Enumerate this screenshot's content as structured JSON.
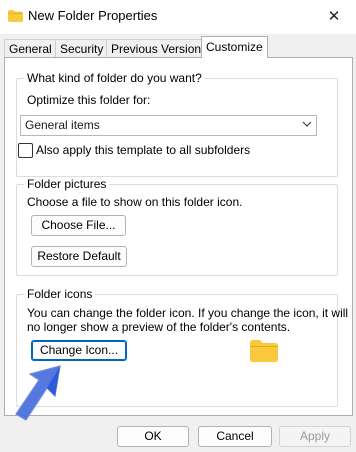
{
  "window": {
    "title": "New Folder Properties",
    "close_glyph": "✕"
  },
  "tabs": [
    {
      "label": "General"
    },
    {
      "label": "Security"
    },
    {
      "label": "Previous Versions"
    },
    {
      "label": "Customize"
    }
  ],
  "active_tab": "Customize",
  "folder_type": {
    "legend": "What kind of folder do you want?",
    "optimize_label": "Optimize this folder for:",
    "selected": "General items",
    "apply_subfolders_label": "Also apply this template to all subfolders",
    "apply_subfolders_checked": false
  },
  "folder_pictures": {
    "legend": "Folder pictures",
    "description": "Choose a file to show on this folder icon.",
    "choose_file_label": "Choose File...",
    "restore_default_label": "Restore Default"
  },
  "folder_icons": {
    "legend": "Folder icons",
    "description_line1": "You can change the folder icon. If you change the icon, it will",
    "description_line2": "no longer show a preview of the folder's contents.",
    "change_icon_label": "Change Icon..."
  },
  "footer": {
    "ok_label": "OK",
    "cancel_label": "Cancel",
    "apply_label": "Apply"
  },
  "colors": {
    "folder_yellow": "#f8c93c",
    "focus_blue": "#0067c0",
    "arrow_blue": "#4a72e0"
  },
  "icons": {
    "title_icon": "folder-icon",
    "dropdown": "chevron-down-icon",
    "preview": "folder-icon",
    "annotation": "arrow-icon"
  }
}
